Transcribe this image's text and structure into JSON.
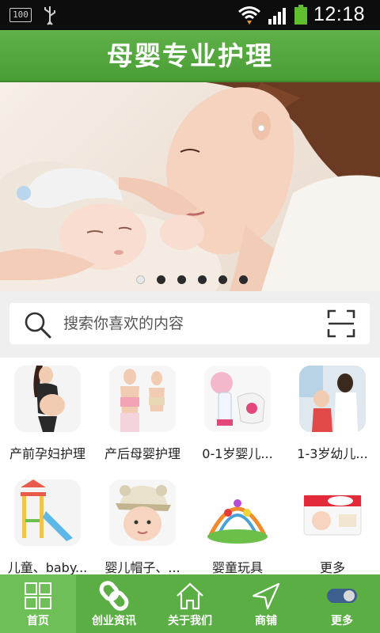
{
  "status_bar": {
    "battery_text": "100",
    "time": "12:18"
  },
  "header": {
    "title": "母婴专业护理"
  },
  "banner": {
    "slide_count": 6,
    "active_index": 0
  },
  "search": {
    "placeholder": "搜索你喜欢的内容",
    "icon": "search-icon",
    "scan_icon": "scan-icon"
  },
  "categories": [
    {
      "label": "产前孕妇护理",
      "icon": "pregnant-woman-photo"
    },
    {
      "label": "产后母婴护理",
      "icon": "postpartum-women-photo"
    },
    {
      "label": "0-1岁婴儿...",
      "icon": "breast-pump-photo"
    },
    {
      "label": "1-3岁幼儿...",
      "icon": "toddler-doctor-photo"
    },
    {
      "label": "儿童、baby...",
      "icon": "playground-slide-photo"
    },
    {
      "label": "婴儿帽子、...",
      "icon": "baby-hat-photo"
    },
    {
      "label": "婴童玩具",
      "icon": "baby-play-gym-photo"
    },
    {
      "label": "更多",
      "icon": "diaper-pack-photo"
    }
  ],
  "bottom_nav": {
    "items": [
      {
        "label": "首页",
        "icon": "grid-icon",
        "active": true
      },
      {
        "label": "创业资讯",
        "icon": "link-icon",
        "active": false
      },
      {
        "label": "关于我们",
        "icon": "home-icon",
        "active": false
      },
      {
        "label": "商铺",
        "icon": "navigation-icon",
        "active": false
      },
      {
        "label": "更多",
        "icon": "toggle-icon",
        "active": false
      }
    ]
  },
  "colors": {
    "brand_green": "#5aae43",
    "status_bar": "#0d0d0d"
  }
}
